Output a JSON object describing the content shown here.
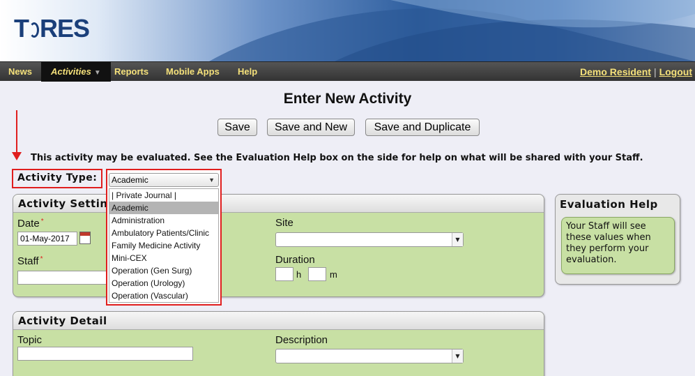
{
  "logo": {
    "text_left": "T",
    "text_right": "RES"
  },
  "nav": {
    "items": [
      "News",
      "Activities",
      "Reports",
      "Mobile Apps",
      "Help"
    ],
    "user": "Demo Resident",
    "separator": "|",
    "logout": "Logout"
  },
  "page": {
    "title": "Enter New Activity",
    "buttons": {
      "save": "Save",
      "save_new": "Save and New",
      "save_duplicate": "Save and Duplicate"
    },
    "notice": "This activity may be evaluated. See the Evaluation Help box on the side for help on what will be shared with your Staff."
  },
  "activity_type": {
    "label": "Activity Type:",
    "selected": "Academic",
    "options": [
      "| Private Journal |",
      "Academic",
      "Administration",
      "Ambulatory Patients/Clinic",
      "Family Medicine Activity",
      "Mini-CEX",
      "Operation (Gen Surg)",
      "Operation (Urology)",
      "Operation (Vascular)"
    ]
  },
  "settings": {
    "title": "Activity Setting",
    "date_label": "Date",
    "date_value": "01-May-2017",
    "required_mark": "*",
    "staff_label": "Staff",
    "site_label": "Site",
    "duration_label": "Duration",
    "hours_unit": "h",
    "minutes_unit": "m"
  },
  "detail": {
    "title": "Activity Detail",
    "topic_label": "Topic",
    "description_label": "Description"
  },
  "help": {
    "title": "Evaluation Help",
    "body": "Your Staff will see these values when they perform your evaluation."
  },
  "colors": {
    "annotation_red": "#e01e1e",
    "panel_green": "#c8e0a4",
    "nav_text": "#f4e07a"
  }
}
